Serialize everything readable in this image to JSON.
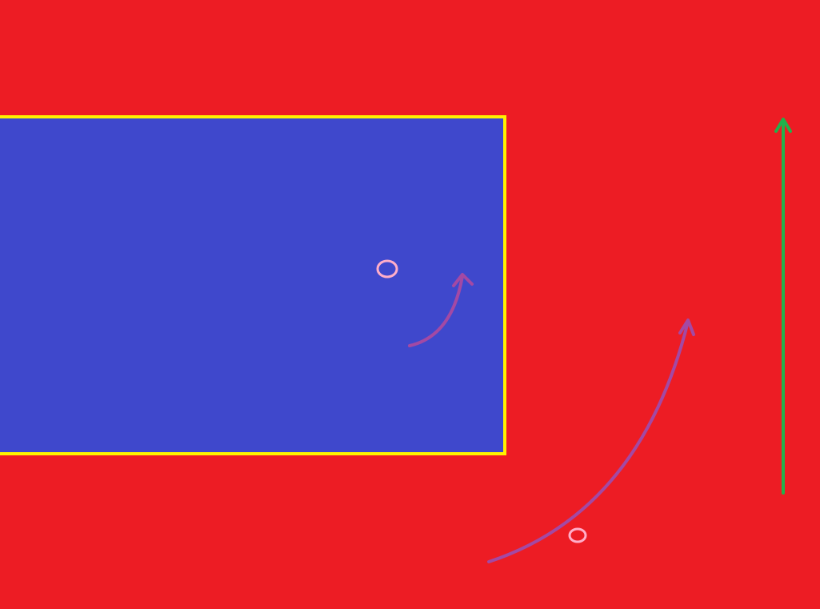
{
  "colors": {
    "background": "#ED1C24",
    "panel_fill": "#3F48CC",
    "panel_border": "#FFF200",
    "marker": "#FFAEC9",
    "arrow_small": "#A349A4",
    "arrow_large": "#A349A4",
    "arrow_vertical": "#22B14C"
  },
  "elements": {
    "panel": "blue-panel",
    "markers": [
      "pink-circle-marker",
      "pink-circle-marker"
    ],
    "arrows": [
      "curved-arrow-icon",
      "curved-arrow-icon",
      "up-arrow-icon"
    ]
  }
}
